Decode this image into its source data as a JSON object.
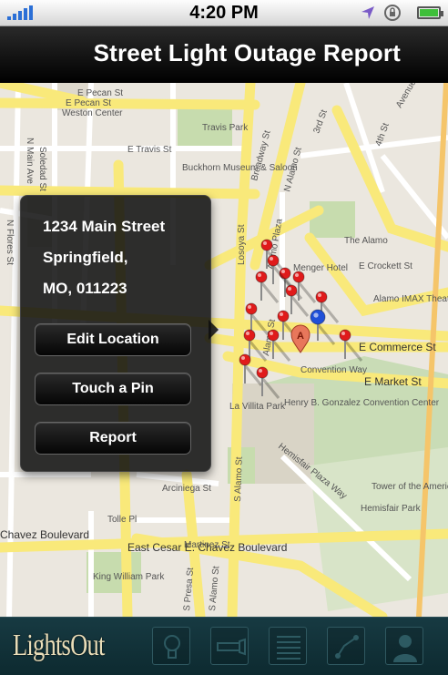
{
  "status_bar": {
    "time": "4:20 PM"
  },
  "header": {
    "title": "Street Light Outage Report"
  },
  "map": {
    "street_labels": {
      "e_pecan_st_top": "E Pecan St",
      "weston_center": "Weston Center",
      "e_pecan_st": "E Pecan St",
      "travis_park": "Travis Park",
      "e_travis_st": "E Travis St",
      "buckhorn": "Buckhorn Museum & Saloon",
      "n_main_ave": "N Main Ave",
      "soledad_st": "Soledad St",
      "broadway_st": "Broadway St",
      "third_st": "3rd St",
      "fourth_st": "4th St",
      "avenue_e": "Avenue E",
      "n_alamo_st": "N Alamo St",
      "losoya_st": "Losoya St",
      "alamo_plaza": "Alamo Plaza",
      "the_alamo": "The Alamo",
      "menger_hotel": "Menger Hotel",
      "e_crockett_st": "E Crockett St",
      "imax": "Alamo IMAX Theatre Rivercenter",
      "e_commerce_st": "E Commerce St",
      "convention_way": "Convention Way",
      "e_market_st": "E Market St",
      "alamo_st": "Alamo St",
      "henry_b": "Henry B. Gonzalez Convention Center",
      "la_villita_park": "La Villita Park",
      "hemisfair_plaza_way": "Hemisfair Plaza Way",
      "arciniega_st": "Arciniega St",
      "s_alamo_st": "S Alamo St",
      "tolle_pl": "Tolle Pl",
      "tower_americas": "Tower of the Americas",
      "hemisfair_park": "Hemisfair Park",
      "chavez_blvd": "Chavez Boulevard",
      "e_cesar_chavez": "East Cesar E. Chavez Boulevard",
      "martinez_st": "Martinez St",
      "king_william_park": "King William Park",
      "s_presa_st": "S Presa St",
      "s_alamo_st_2": "S Alamo St",
      "n_flores_st": "N Flores St",
      "marker_letter": "A"
    }
  },
  "popover": {
    "address_line1": "1234 Main Street",
    "address_line2": "Springfield,",
    "address_line3": "MO, 011223",
    "edit_location": "Edit Location",
    "touch_pin": "Touch a Pin",
    "report": "Report"
  },
  "tabbar": {
    "logo": "LightsOut",
    "tabs": [
      "lightbulb-icon",
      "flashlight-icon",
      "list-icon",
      "route-icon",
      "person-icon"
    ]
  },
  "colors": {
    "road_major": "#f9e97a",
    "road_minor": "#ffffff",
    "park": "#c7dcae",
    "pin_red": "#e01b1b",
    "pin_blue": "#1f4fd8",
    "tabbar": "#143740"
  }
}
